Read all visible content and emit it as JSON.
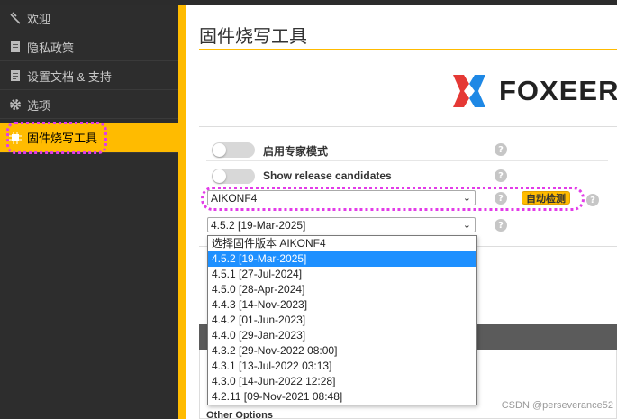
{
  "sidebar": {
    "items": [
      {
        "label": "欢迎",
        "icon": "plug-icon"
      },
      {
        "label": "隐私政策",
        "icon": "document-icon"
      },
      {
        "label": "设置文档 & 支持",
        "icon": "document-icon"
      },
      {
        "label": "选项",
        "icon": "gear-icon"
      },
      {
        "label": "固件烧写工具",
        "icon": "chip-icon",
        "active": true
      }
    ]
  },
  "main": {
    "title": "固件烧写工具",
    "logo_text": "FOXEER",
    "expert_mode_label": "启用专家模式",
    "release_candidates_label": "Show release candidates",
    "board_select_value": "AIKONF4",
    "auto_detect_label": "自动检测",
    "version_select_value": "4.5.2 [19-Mar-2025]",
    "other_options_label": "Other Options",
    "help_symbol": "?"
  },
  "version_dropdown": {
    "header": "选择固件版本 AIKONF4",
    "options": [
      "4.5.2 [19-Mar-2025]",
      "4.5.1 [27-Jul-2024]",
      "4.5.0 [28-Apr-2024]",
      "4.4.3 [14-Nov-2023]",
      "4.4.2 [01-Jun-2023]",
      "4.4.0 [29-Jan-2023]",
      "4.3.2 [29-Nov-2022 08:00]",
      "4.3.1 [13-Jul-2022 03:13]",
      "4.3.0 [14-Jun-2022 12:28]",
      "4.2.11 [09-Nov-2021 08:48]"
    ],
    "selected_index": 0
  },
  "watermark": "CSDN @perseverance52",
  "colors": {
    "accent": "#ffbb00",
    "sidebar_bg": "#2d2d2d",
    "highlight": "#e23ce8",
    "selected": "#1e90ff",
    "logo_red": "#e53935",
    "logo_blue": "#1e88e5"
  }
}
